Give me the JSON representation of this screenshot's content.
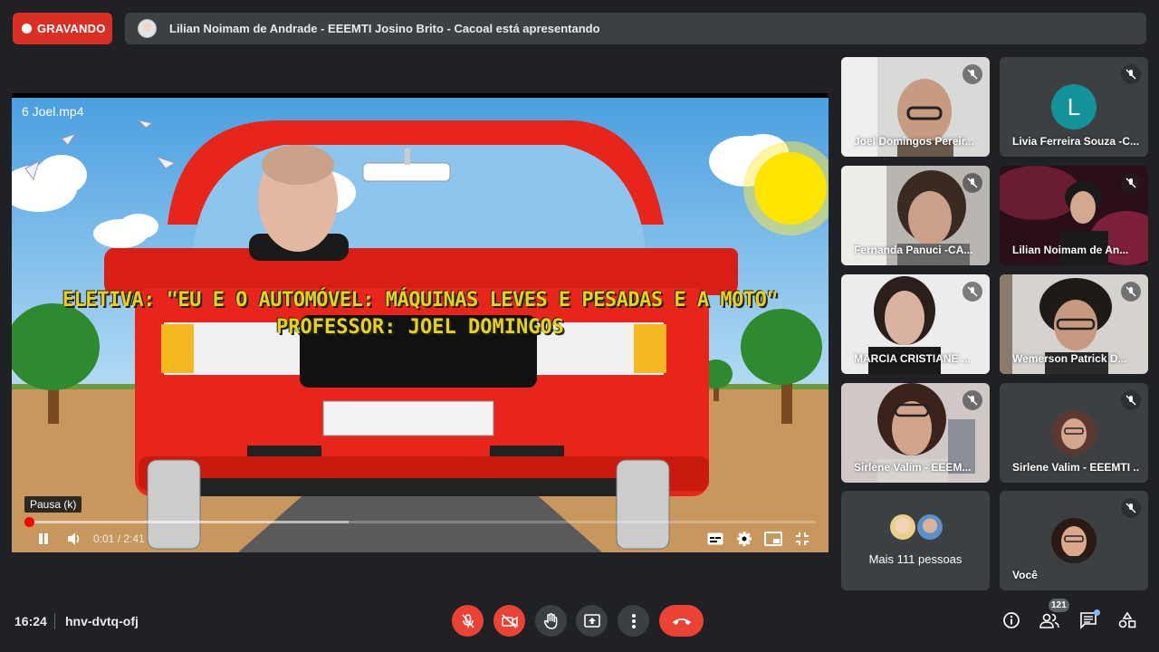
{
  "recording": {
    "label": "GRAVANDO"
  },
  "presentation": {
    "text": "Lilian Noimam de Andrade - EEEMTI Josino Brito - Cacoal está apresentando"
  },
  "video": {
    "title": "6 Joel.mp4",
    "caption_line1": "ELETIVA: \"EU E O AUTOMÓVEL: MÁQUINAS LEVES E PESADAS E A MOTO\"",
    "caption_line2": "PROFESSOR: JOEL DOMINGOS",
    "tooltip": "Pausa (k)",
    "time": "0:01 / 2:41",
    "played_fraction": 0.006,
    "buffered_fraction": 0.41
  },
  "participants": [
    {
      "name": "Joel Domingos Pereir...",
      "muted": true
    },
    {
      "name": "Livia Ferreira Souza -C...",
      "avatar_letter": "L",
      "muted": true
    },
    {
      "name": "Fernanda Panuci -CA...",
      "muted": true
    },
    {
      "name": "Lilian Noimam de An...",
      "muted": true
    },
    {
      "name": "MARCIA CRISTIANE ...",
      "muted": true
    },
    {
      "name": "Wemerson Patrick D...",
      "muted": true
    },
    {
      "name": "Sirlene Valim - EEEM...",
      "muted": true
    },
    {
      "name": "Sirlene Valim - EEEMTI ...",
      "muted": true
    },
    {
      "name": "Mais 111 pessoas"
    },
    {
      "name": "Você",
      "muted": true
    }
  ],
  "bottom_bar": {
    "clock": "16:24",
    "meeting_code": "hnv-dvtq-ofj",
    "participant_count": "121"
  },
  "colors": {
    "recording": "#d93025",
    "danger": "#ea4335",
    "tile_bg": "#3c4043",
    "page_bg": "#202124",
    "livia_avatar": "#12939a"
  },
  "icons": [
    "record-dot",
    "mic-off-icon",
    "camera-off-icon",
    "raise-hand-icon",
    "present-icon",
    "more-options-icon",
    "hang-up-icon",
    "info-icon",
    "people-icon",
    "chat-icon",
    "activities-icon",
    "play-pause-icon",
    "volume-icon",
    "subtitles-icon",
    "settings-icon",
    "miniplayer-icon",
    "exit-fullscreen-icon"
  ]
}
